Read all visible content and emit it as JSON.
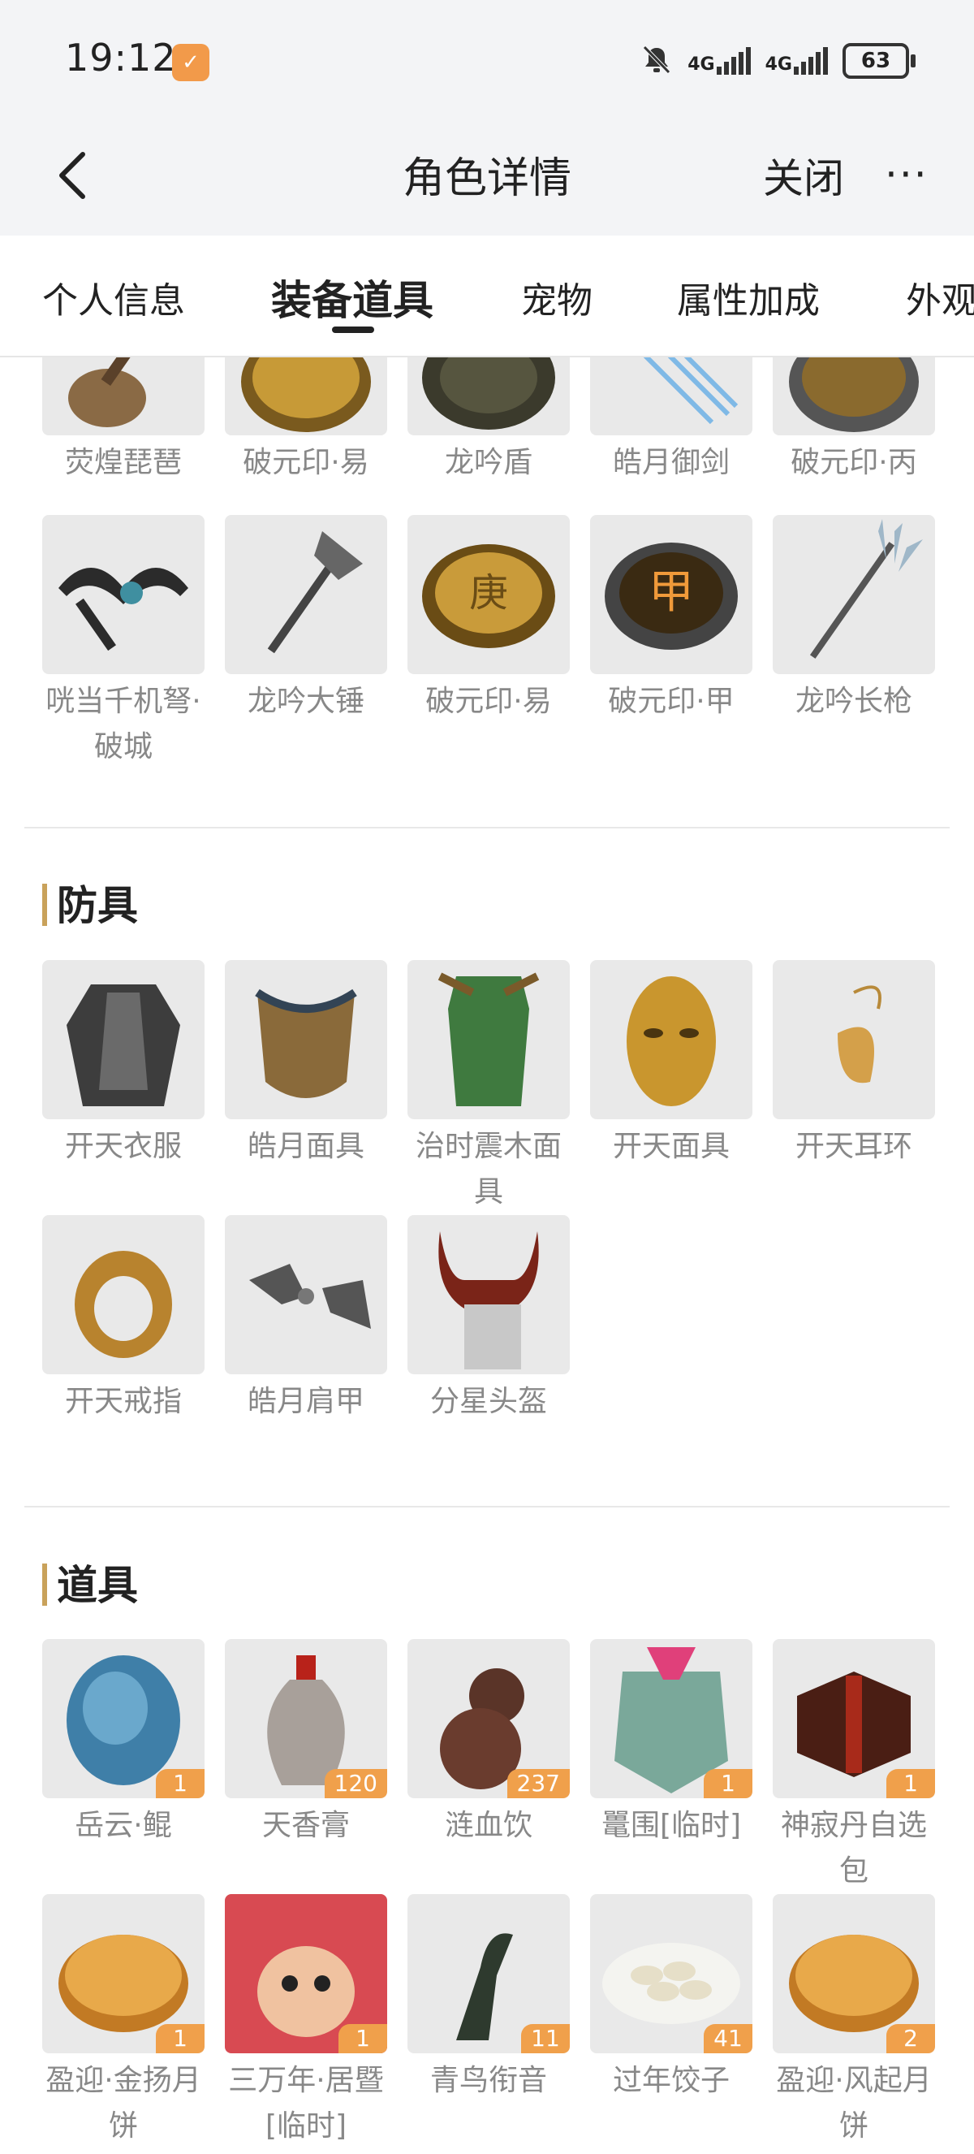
{
  "status": {
    "time": "19:12",
    "net1": "4G",
    "net2": "4G",
    "battery": "63"
  },
  "header": {
    "title": "角色详情",
    "close_label": "关闭",
    "more_label": "···"
  },
  "tabs": [
    "个人信息",
    "装备道具",
    "宠物",
    "属性加成",
    "外观"
  ],
  "weapons_partial_row": [
    {
      "name": "荧煌琵琶",
      "icon": "pipa-icon"
    },
    {
      "name": "破元印·易",
      "icon": "seal-icon"
    },
    {
      "name": "龙吟盾",
      "icon": "shield-icon"
    },
    {
      "name": "皓月御剑",
      "icon": "flying-swords-icon"
    },
    {
      "name": "破元印·丙",
      "icon": "seal-icon"
    }
  ],
  "weapons_row2": [
    {
      "name": "咣当千机弩·破城",
      "icon": "crossbow-icon"
    },
    {
      "name": "龙吟大锤",
      "icon": "hammer-icon"
    },
    {
      "name": "破元印·易",
      "icon": "seal-icon"
    },
    {
      "name": "破元印·甲",
      "icon": "seal-icon"
    },
    {
      "name": "龙吟长枪",
      "icon": "spear-icon"
    }
  ],
  "armor": {
    "title": "防具",
    "items": [
      {
        "name": "开天衣服",
        "icon": "armor-icon"
      },
      {
        "name": "皓月面具",
        "icon": "mask-icon"
      },
      {
        "name": "治时震木面具",
        "icon": "mask-icon"
      },
      {
        "name": "开天面具",
        "icon": "gold-mask-icon"
      },
      {
        "name": "开天耳环",
        "icon": "earring-icon"
      },
      {
        "name": "开天戒指",
        "icon": "ring-icon"
      },
      {
        "name": "皓月肩甲",
        "icon": "shoulder-icon"
      },
      {
        "name": "分星头盔",
        "icon": "helmet-icon"
      }
    ]
  },
  "props": {
    "title": "道具",
    "items": [
      {
        "name": "岳云·鲲",
        "count": "1",
        "icon": "stone-icon"
      },
      {
        "name": "天香膏",
        "count": "120",
        "icon": "jar-icon"
      },
      {
        "name": "涟血饮",
        "count": "237",
        "icon": "gourd-icon"
      },
      {
        "name": "鼍围[临时]",
        "count": "1",
        "icon": "beast-icon"
      },
      {
        "name": "神寂丹自选包",
        "count": "1",
        "icon": "box-icon"
      },
      {
        "name": "盈迎·金扬月饼",
        "count": "1",
        "icon": "mooncake-icon"
      },
      {
        "name": "三万年·居暨[临时]",
        "count": "1",
        "icon": "pet-icon"
      },
      {
        "name": "青鸟衔音",
        "count": "11",
        "icon": "bird-whistle-icon"
      },
      {
        "name": "过年饺子",
        "count": "41",
        "icon": "dumplings-icon"
      },
      {
        "name": "盈迎·风起月饼",
        "count": "2",
        "icon": "mooncake-icon"
      }
    ]
  }
}
